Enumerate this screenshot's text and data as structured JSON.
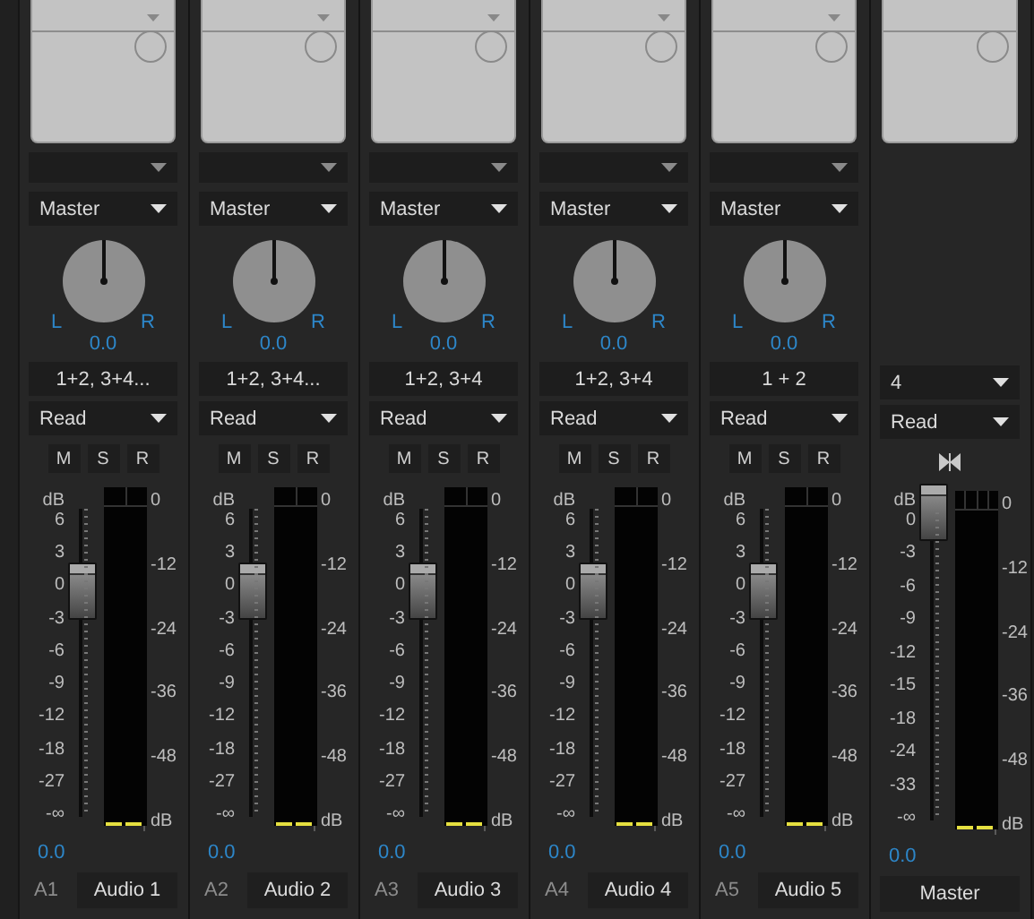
{
  "channels": [
    {
      "kind": "track",
      "id": "A1",
      "name": "Audio 1",
      "route": "Master",
      "pan": "0.0",
      "pan_left": "L",
      "pan_right": "R",
      "output": "1+2, 3+4...",
      "automation": "Read",
      "buttons": [
        "M",
        "S",
        "R"
      ],
      "fader": {
        "level": 0.73,
        "unit": "dB",
        "scale": [
          "6",
          "3",
          "0",
          "-3",
          "-6",
          "-9",
          "-12",
          "-18",
          "-27",
          "-∞"
        ]
      },
      "meter": {
        "scale": [
          "0",
          "-12",
          "-24",
          "-36",
          "-48",
          "dB"
        ]
      },
      "volume": "0.0"
    },
    {
      "kind": "track",
      "id": "A2",
      "name": "Audio 2",
      "route": "Master",
      "pan": "0.0",
      "pan_left": "L",
      "pan_right": "R",
      "output": "1+2, 3+4...",
      "automation": "Read",
      "buttons": [
        "M",
        "S",
        "R"
      ],
      "fader": {
        "level": 0.73,
        "unit": "dB",
        "scale": [
          "6",
          "3",
          "0",
          "-3",
          "-6",
          "-9",
          "-12",
          "-18",
          "-27",
          "-∞"
        ]
      },
      "meter": {
        "scale": [
          "0",
          "-12",
          "-24",
          "-36",
          "-48",
          "dB"
        ]
      },
      "volume": "0.0"
    },
    {
      "kind": "track",
      "id": "A3",
      "name": "Audio 3",
      "route": "Master",
      "pan": "0.0",
      "pan_left": "L",
      "pan_right": "R",
      "output": "1+2, 3+4",
      "automation": "Read",
      "buttons": [
        "M",
        "S",
        "R"
      ],
      "fader": {
        "level": 0.73,
        "unit": "dB",
        "scale": [
          "6",
          "3",
          "0",
          "-3",
          "-6",
          "-9",
          "-12",
          "-18",
          "-27",
          "-∞"
        ]
      },
      "meter": {
        "scale": [
          "0",
          "-12",
          "-24",
          "-36",
          "-48",
          "dB"
        ]
      },
      "volume": "0.0"
    },
    {
      "kind": "track",
      "id": "A4",
      "name": "Audio 4",
      "route": "Master",
      "pan": "0.0",
      "pan_left": "L",
      "pan_right": "R",
      "output": "1+2, 3+4",
      "automation": "Read",
      "buttons": [
        "M",
        "S",
        "R"
      ],
      "fader": {
        "level": 0.73,
        "unit": "dB",
        "scale": [
          "6",
          "3",
          "0",
          "-3",
          "-6",
          "-9",
          "-12",
          "-18",
          "-27",
          "-∞"
        ]
      },
      "meter": {
        "scale": [
          "0",
          "-12",
          "-24",
          "-36",
          "-48",
          "dB"
        ]
      },
      "volume": "0.0"
    },
    {
      "kind": "track",
      "id": "A5",
      "name": "Audio 5",
      "route": "Master",
      "pan": "0.0",
      "pan_left": "L",
      "pan_right": "R",
      "output": "1 + 2",
      "automation": "Read",
      "buttons": [
        "M",
        "S",
        "R"
      ],
      "fader": {
        "level": 0.73,
        "unit": "dB",
        "scale": [
          "6",
          "3",
          "0",
          "-3",
          "-6",
          "-9",
          "-12",
          "-18",
          "-27",
          "-∞"
        ]
      },
      "meter": {
        "scale": [
          "0",
          "-12",
          "-24",
          "-36",
          "-48",
          "dB"
        ]
      },
      "volume": "0.0"
    },
    {
      "kind": "master",
      "name": "Master",
      "output": "4",
      "automation": "Read",
      "fader": {
        "level": 1,
        "unit": "dB",
        "scale": [
          "0",
          "-3",
          "-6",
          "-9",
          "-12",
          "-15",
          "-18",
          "-24",
          "-33",
          "-∞"
        ]
      },
      "meter": {
        "scale": [
          "0",
          "-12",
          "-24",
          "-36",
          "-48",
          "dB"
        ]
      },
      "volume": "0.0"
    }
  ]
}
